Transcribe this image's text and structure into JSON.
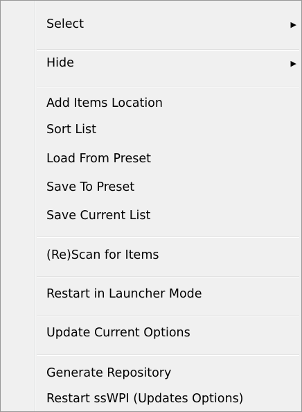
{
  "menu": {
    "items": [
      {
        "label": "Select",
        "submenu_arrow": "▶"
      },
      {
        "label": "Hide",
        "submenu_arrow": "▶"
      },
      {
        "label": "Add Items Location"
      },
      {
        "label": "Sort List"
      },
      {
        "label": "Load From Preset"
      },
      {
        "label": "Save To Preset"
      },
      {
        "label": "Save Current List"
      },
      {
        "label": "(Re)Scan for Items"
      },
      {
        "label": "Restart in Launcher Mode"
      },
      {
        "label": "Update Current Options"
      },
      {
        "label": "Generate Repository"
      },
      {
        "label": "Restart ssWPI (Updates Options)"
      }
    ],
    "colors": {
      "background": "#f0f0f0",
      "border": "#979797",
      "separator": "#e0e0e0",
      "text": "#000000"
    }
  }
}
